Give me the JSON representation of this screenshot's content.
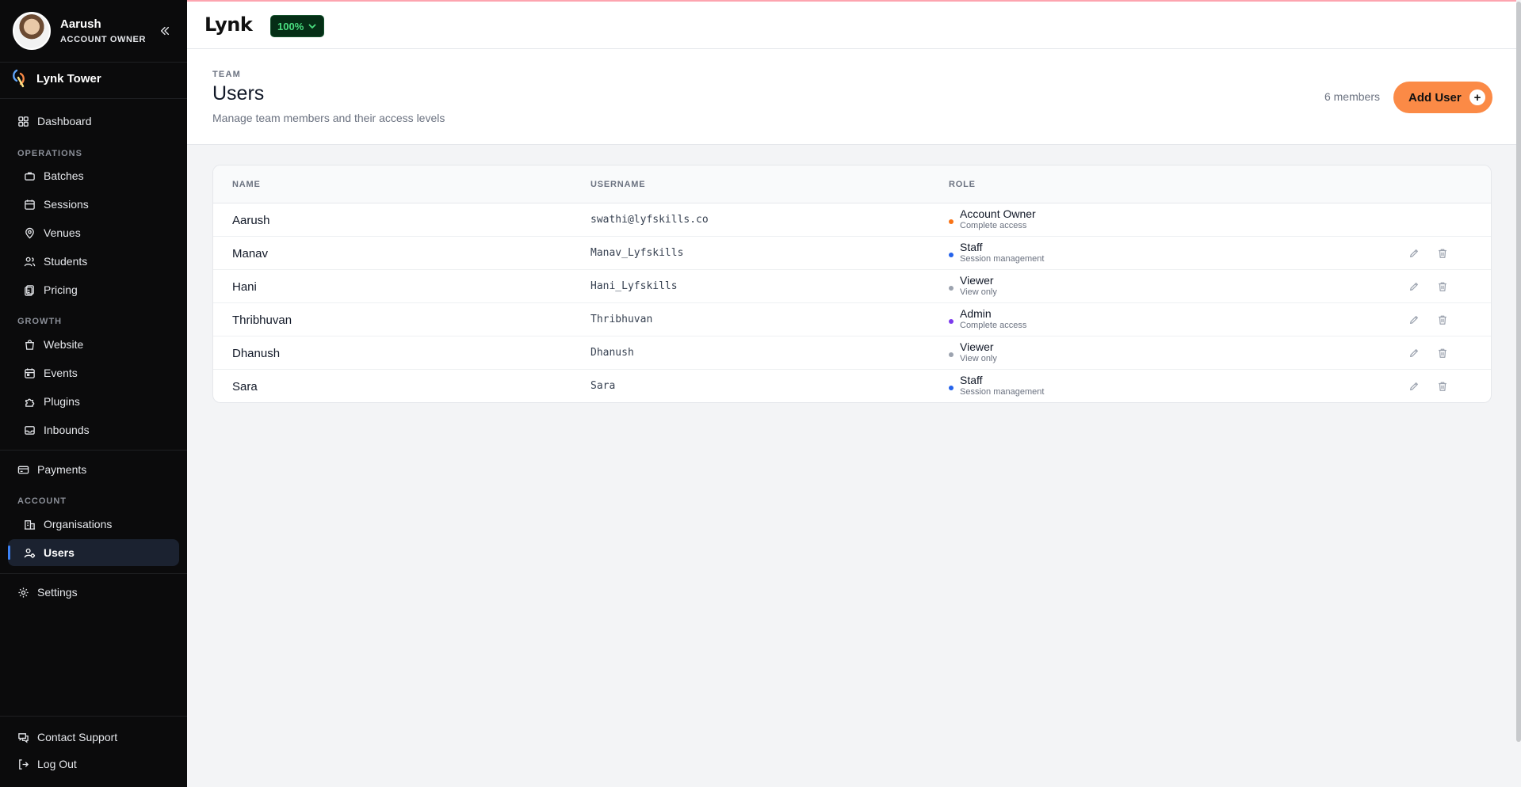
{
  "sidebar": {
    "user": {
      "name": "Aarush",
      "role": "ACCOUNT OWNER"
    },
    "org_name": "Lynk Tower",
    "dashboard": "Dashboard",
    "sections": {
      "operations": "OPERATIONS",
      "growth": "GROWTH",
      "account": "ACCOUNT"
    },
    "operations_items": [
      "Batches",
      "Sessions",
      "Venues",
      "Students",
      "Pricing"
    ],
    "growth_items": [
      "Website",
      "Events",
      "Plugins",
      "Inbounds"
    ],
    "payments": "Payments",
    "account_items": [
      "Organisations",
      "Users"
    ],
    "settings": "Settings",
    "footer": {
      "support": "Contact Support",
      "logout": "Log Out"
    }
  },
  "topbar": {
    "brand": "Lynk",
    "zoom": "100%"
  },
  "header": {
    "eyebrow": "TEAM",
    "title": "Users",
    "subtitle": "Manage team members and their access levels",
    "member_count": "6 members",
    "add_label": "Add User"
  },
  "table": {
    "columns": [
      "NAME",
      "USERNAME",
      "ROLE"
    ],
    "rows": [
      {
        "name": "Aarush",
        "username": "swathi@lyfskills.co",
        "role": "Account Owner",
        "desc": "Complete access",
        "dot": "#f97316",
        "editable": false
      },
      {
        "name": "Manav",
        "username": "Manav_Lyfskills",
        "role": "Staff",
        "desc": "Session management",
        "dot": "#2563eb",
        "editable": true
      },
      {
        "name": "Hani",
        "username": "Hani_Lyfskills",
        "role": "Viewer",
        "desc": "View only",
        "dot": "#9ca3af",
        "editable": true
      },
      {
        "name": "Thribhuvan",
        "username": "Thribhuvan",
        "role": "Admin",
        "desc": "Complete access",
        "dot": "#7c3aed",
        "editable": true
      },
      {
        "name": "Dhanush",
        "username": "Dhanush",
        "role": "Viewer",
        "desc": "View only",
        "dot": "#9ca3af",
        "editable": true
      },
      {
        "name": "Sara",
        "username": "Sara",
        "role": "Staff",
        "desc": "Session management",
        "dot": "#2563eb",
        "editable": true
      }
    ]
  },
  "colors": {
    "accent": "#fb8a46",
    "sidebar_bg": "#0b0b0c",
    "active_indicator": "#3b82f6",
    "zoom_text": "#4ade80"
  }
}
